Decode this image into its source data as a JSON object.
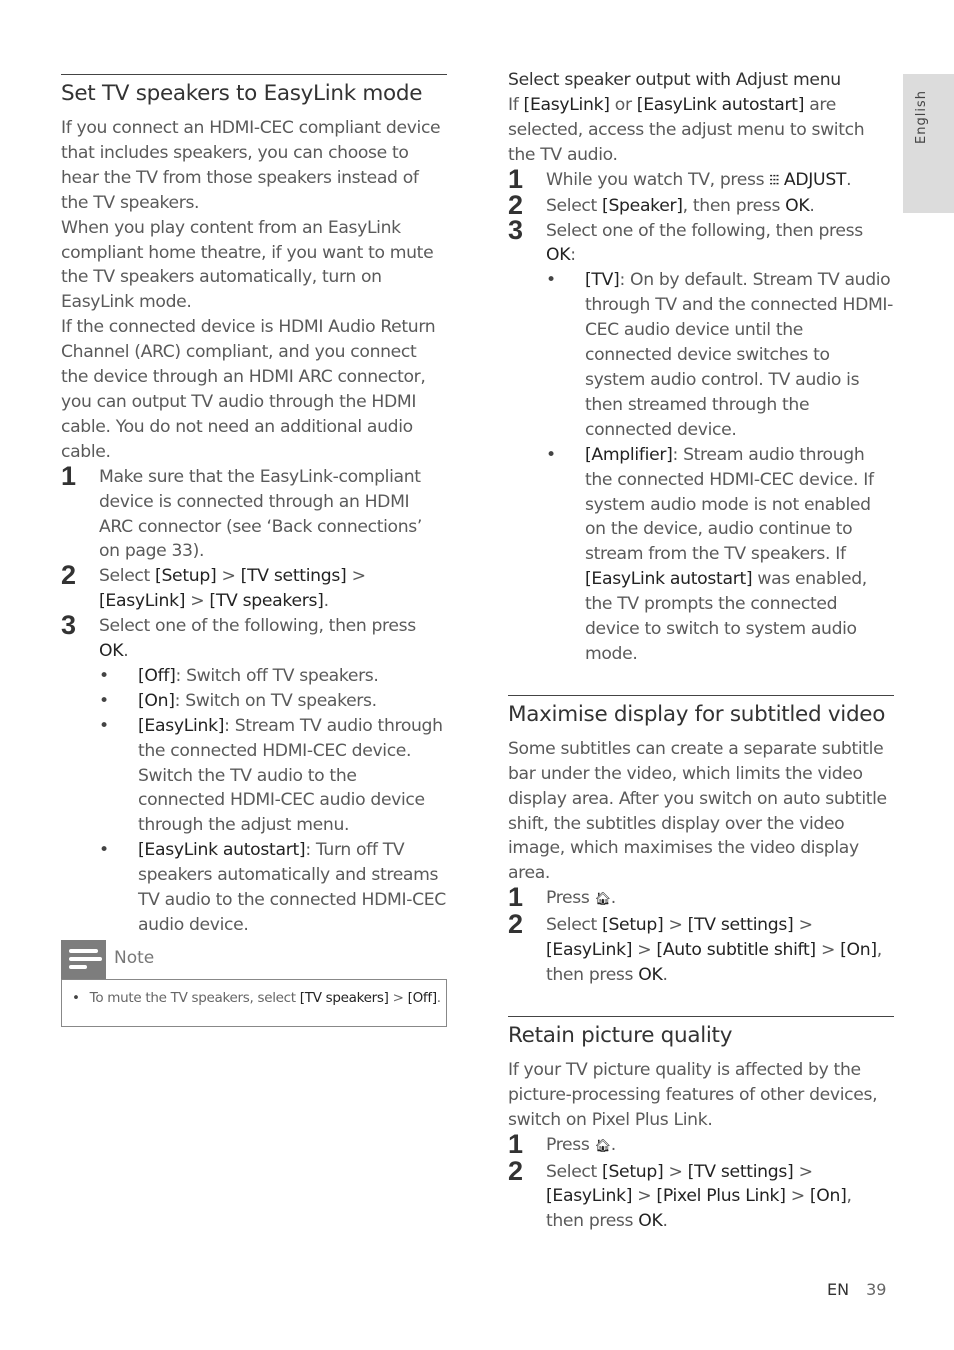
{
  "side_tab": {
    "label": "English"
  },
  "footer": {
    "lang": "EN",
    "page": "39"
  },
  "left": {
    "title": "Set TV speakers to EasyLink mode",
    "paragraphs": [
      "If you connect an HDMI-CEC compliant device that includes speakers, you can choose to hear the TV from those speakers instead of the TV speakers.",
      "When you play content from an EasyLink compliant home theatre, if you want to mute the TV speakers automatically, turn on EasyLink mode.",
      "If the connected device is HDMI Audio Return Channel (ARC) compliant, and you connect the device through an HDMI ARC connector, you can output TV audio through the HDMI cable. You do not need an additional audio cable."
    ],
    "steps": [
      {
        "num": "1",
        "text": "Make sure that the EasyLink-compliant device is connected through an HDMI ARC connector (see ‘Back connections’ on page 33)."
      },
      {
        "num": "2",
        "pre": "Select ",
        "p1": "[Setup]",
        "s1": " > ",
        "p2": "[TV settings]",
        "s2": " > ",
        "p3": "[EasyLink]",
        "s3": " > ",
        "p4": "[TV speakers]",
        "post": "."
      },
      {
        "num": "3",
        "pre": "Select one of the following, then press ",
        "key": "OK",
        "post": "."
      }
    ],
    "options": [
      {
        "label": "[Off]",
        "text": ": Switch off TV speakers."
      },
      {
        "label": "[On]",
        "text": ": Switch on TV speakers."
      },
      {
        "label": "[EasyLink]",
        "text": ": Stream TV audio through the connected HDMI-CEC device. Switch the TV audio to the connected HDMI-CEC audio device through the adjust menu."
      },
      {
        "label": "[EasyLink autostart]",
        "text": ": Turn off TV speakers automatically and streams TV audio to the connected HDMI-CEC audio device."
      }
    ],
    "note": {
      "label": "Note",
      "pre": "To mute the TV speakers, select ",
      "p1": "[TV speakers]",
      "sep": " > ",
      "p2": "[Off]",
      "post": "."
    }
  },
  "right": {
    "adjust": {
      "subtitle": "Select speaker output with Adjust menu",
      "intro_pre": "If ",
      "intro_p1": "[EasyLink]",
      "intro_mid": " or ",
      "intro_p2": "[EasyLink autostart]",
      "intro_post": " are selected, access the adjust menu to switch the TV audio.",
      "step1_pre": "While you watch TV, press ",
      "step1_icon": "adjust-icon",
      "step1_key": "ADJUST",
      "step1_post": ".",
      "step2_pre": "Select ",
      "step2_opt": "[Speaker]",
      "step2_mid": ", then press ",
      "step2_key": "OK",
      "step2_post": ".",
      "step3_pre": "Select one of the following, then press ",
      "step3_key": "OK",
      "step3_post": ":",
      "options": [
        {
          "label": "[TV]",
          "text": ": On by default. Stream TV audio through TV and the connected HDMI-CEC audio device until the connected device switches to system audio control. TV audio is then streamed through the connected device."
        },
        {
          "label": "[Amplifier]",
          "text": ": Stream audio through the connected HDMI-CEC device. If system audio mode is not enabled on the device, audio continue to stream from the TV speakers. If ",
          "label2": "[EasyLink autostart]",
          "text2": " was enabled, the TV prompts the connected device to switch to system audio mode."
        }
      ]
    },
    "subtitled": {
      "title": "Maximise display for subtitled video",
      "paragraph": "Some subtitles can create a separate subtitle bar under the video, which limits the video display area. After you switch on auto subtitle shift, the subtitles display over the video image, which maximises the video display area.",
      "step1_pre": "Press ",
      "step1_post": ".",
      "step2_pre": "Select ",
      "p1": "[Setup]",
      "p2": "[TV settings]",
      "p3": "[EasyLink]",
      "p4": "[Auto subtitle shift]",
      "p5": "[On]",
      "sep": " > ",
      "step2_post": ", then press ",
      "key": "OK",
      "end": "."
    },
    "picture": {
      "title": "Retain picture quality",
      "paragraph": "If your TV picture quality is affected by the picture-processing features of other devices, switch on Pixel Plus Link.",
      "step1_pre": "Press ",
      "step1_post": ".",
      "step2_pre": "Select ",
      "p1": "[Setup]",
      "p2": "[TV settings]",
      "p3": "[EasyLink]",
      "p4": "[Pixel Plus Link]",
      "p5": "[On]",
      "sep": " > ",
      "step2_post": ", then press ",
      "key": "OK",
      "end": "."
    }
  }
}
